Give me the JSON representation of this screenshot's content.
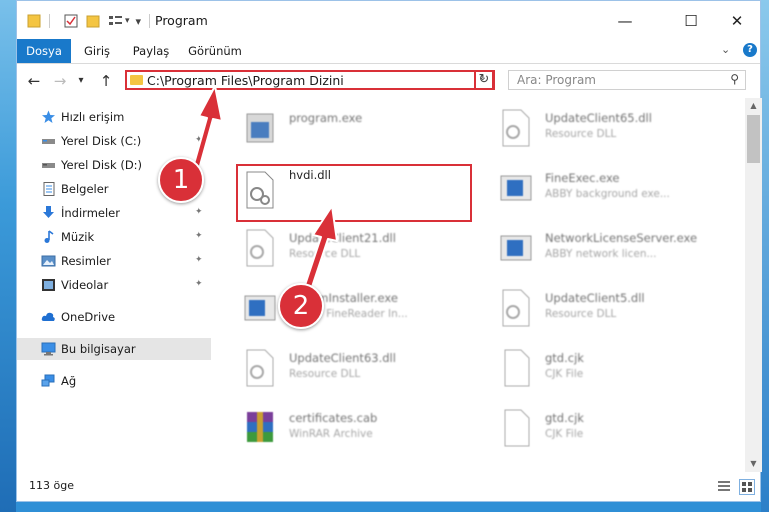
{
  "window": {
    "title": "Program",
    "controls": {
      "minimize": "—",
      "maximize": "☐",
      "close": "✕"
    }
  },
  "ribbon": {
    "tabs": [
      "Dosya",
      "Giriş",
      "Paylaş",
      "Görünüm"
    ],
    "expand_icon": "chevron-down-icon",
    "help_icon": "?"
  },
  "nav": {
    "back": "←",
    "forward": "→",
    "recent": "▾",
    "up": "↑",
    "address": "C:\\Program Files\\Program Dizini",
    "address_drop": "⌄",
    "refresh": "↻",
    "search_placeholder": "Ara: Program",
    "search_glyph": "⚲"
  },
  "sidebar": {
    "items": [
      {
        "label": "Hızlı erişim",
        "icon": "star-icon"
      },
      {
        "label": "Yerel Disk (C:)",
        "icon": "drive-icon",
        "pinned": true
      },
      {
        "label": "Yerel Disk (D:)",
        "icon": "drive-icon",
        "pinned": true
      },
      {
        "label": "Belgeler",
        "icon": "documents-icon",
        "pinned": true
      },
      {
        "label": "İndirmeler",
        "icon": "download-icon",
        "pinned": true
      },
      {
        "label": "Müzik",
        "icon": "music-icon",
        "pinned": true
      },
      {
        "label": "Resimler",
        "icon": "pictures-icon",
        "pinned": true
      },
      {
        "label": "Videolar",
        "icon": "videos-icon",
        "pinned": true
      },
      {
        "label": "OneDrive",
        "icon": "cloud-icon"
      },
      {
        "label": "Bu bilgisayar",
        "icon": "computer-icon",
        "selected": true
      },
      {
        "label": "Ağ",
        "icon": "network-icon"
      }
    ],
    "pin_glyph": "📌"
  },
  "files": {
    "left": [
      {
        "name": "program.exe",
        "desc": ""
      },
      {
        "name": "hvdi.dll",
        "desc": ""
      },
      {
        "name": "UpdateClient21.dll",
        "desc": "Resource DLL"
      },
      {
        "name": "TrammInstaller.exe",
        "desc": "ABBYY FineReader In..."
      },
      {
        "name": "UpdateClient63.dll",
        "desc": "Resource DLL"
      },
      {
        "name": "certificates.cab",
        "desc": "WinRAR Archive"
      }
    ],
    "right": [
      {
        "name": "UpdateClient65.dll",
        "desc": "Resource DLL"
      },
      {
        "name": "FineExec.exe",
        "desc": "ABBY background exe..."
      },
      {
        "name": "NetworkLicenseServer.exe",
        "desc": "ABBY network licen..."
      },
      {
        "name": "UpdateClient5.dll",
        "desc": "Resource DLL"
      },
      {
        "name": "gtd.cjk",
        "desc": "CJK File"
      },
      {
        "name": "gtd.cjk",
        "desc": "CJK File"
      }
    ]
  },
  "status": {
    "count": "113 öge"
  },
  "annotations": {
    "step1": "1",
    "step2": "2",
    "color": "#d93038"
  }
}
